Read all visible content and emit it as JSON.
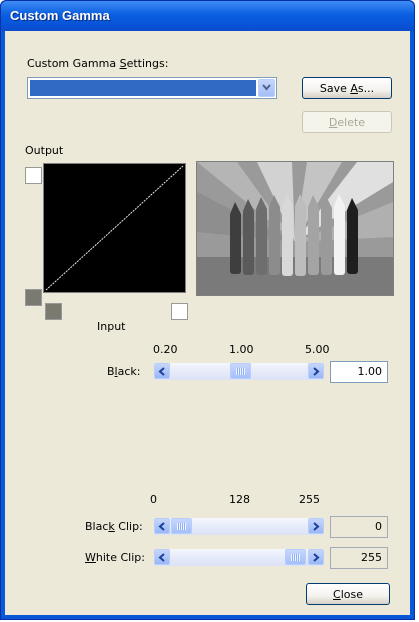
{
  "window": {
    "title": "Custom Gamma"
  },
  "settings": {
    "label": "Custom Gamma Settings:",
    "label_pre": "Custom Gamma ",
    "label_mnemonic": "S",
    "label_post": "ettings:",
    "selected_value": ""
  },
  "buttons": {
    "save_as": {
      "pre": "Save ",
      "mnemonic": "A",
      "post": "s..."
    },
    "delete": {
      "pre": "",
      "mnemonic": "D",
      "post": "elete",
      "enabled": false
    },
    "close": {
      "pre": "",
      "mnemonic": "C",
      "post": "lose"
    }
  },
  "curve": {
    "output_label": "Output",
    "input_label": "Input"
  },
  "black": {
    "label_pre": "B",
    "label_mnemonic": "l",
    "label_post": "ack:",
    "scale": [
      "0.20",
      "1.00",
      "5.00"
    ],
    "value": "1.00"
  },
  "clip": {
    "scale": [
      "0",
      "128",
      "255"
    ],
    "black_clip": {
      "label_pre": "Blac",
      "label_mnemonic": "k",
      "label_post": " Clip:",
      "value": "0"
    },
    "white_clip": {
      "label_pre": "",
      "label_mnemonic": "W",
      "label_post": "hite Clip:",
      "value": "255"
    }
  },
  "colors": {
    "title_bar": "#0a57d8",
    "selection": "#316ac5",
    "dialog_bg": "#ece9d8"
  },
  "icons": {
    "dropdown": "chevron-down-icon",
    "scroll_left": "chevron-left-icon",
    "scroll_right": "chevron-right-icon"
  }
}
